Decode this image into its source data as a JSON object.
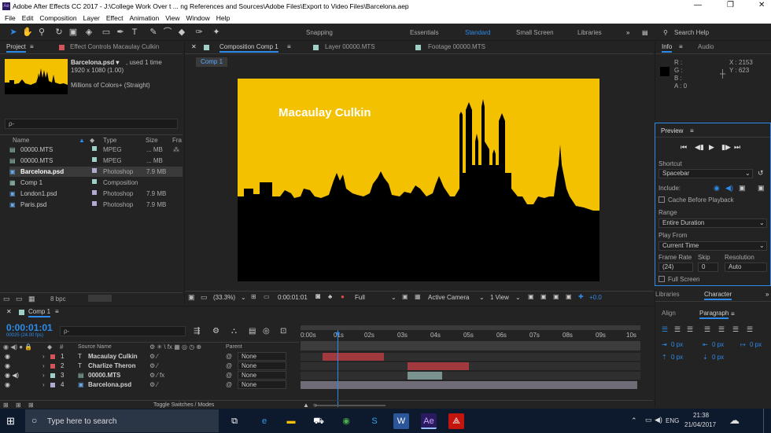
{
  "window": {
    "title": "Adobe After Effects CC 2017 - J:\\College Work Over t ... ng References and Sources\\Adobe Files\\Export to Video Files\\Barcelona.aep",
    "min": "—",
    "max": "❐",
    "close": "✕"
  },
  "menu": [
    "File",
    "Edit",
    "Composition",
    "Layer",
    "Effect",
    "Animation",
    "View",
    "Window",
    "Help"
  ],
  "toolbar": {
    "snapping": "Snapping",
    "workspaces": [
      "Essentials",
      "Standard",
      "Small Screen",
      "Libraries"
    ],
    "search_placeholder": "Search Help"
  },
  "project": {
    "tab": "Project",
    "effect_tab": "Effect Controls Macaulay Culkin",
    "selected_name": "Barcelona.psd ▾",
    "used": ", used 1 time",
    "dims": "1920 x 1080 (1.00)",
    "colors": "Millions of Colors+ (Straight)",
    "search_icon": "ρ-",
    "cols": [
      "Name",
      "Type",
      "Size",
      "Fra"
    ],
    "items": [
      {
        "name": "00000.MTS",
        "type": "MPEG",
        "size": "... MB",
        "color": "#9fd0c8"
      },
      {
        "name": "00000.MTS",
        "type": "MPEG",
        "size": "... MB",
        "color": "#9fd0c8"
      },
      {
        "name": "Barcelona.psd",
        "type": "Photoshop",
        "size": "7.9 MB",
        "color": "#b3a8d0"
      },
      {
        "name": "Comp 1",
        "type": "Composition",
        "size": "",
        "color": "#9fd0c8"
      },
      {
        "name": "London1.psd",
        "type": "Photoshop",
        "size": "7.9 MB",
        "color": "#b3a8d0"
      },
      {
        "name": "Paris.psd",
        "type": "Photoshop",
        "size": "7.9 MB",
        "color": "#b3a8d0"
      }
    ],
    "bpc": "8 bpc"
  },
  "comp": {
    "tabs": [
      "Composition Comp 1",
      "Layer 00000.MTS",
      "Footage 00000.MTS"
    ],
    "subtab": "Comp 1",
    "overlay_text": "Macaulay Culkin",
    "zoom": "(33.3%)",
    "time": "0:00:01:01",
    "resolution": "Full",
    "camera": "Active Camera",
    "view": "1 View",
    "exposure": "+0.0",
    "bg": "#f3c100"
  },
  "info": {
    "tabs": [
      "Info",
      "Audio"
    ],
    "r": "R :",
    "g": "G :",
    "b": "B :",
    "a": "A : 0",
    "x": "X : 2153",
    "y": "Y : 623"
  },
  "preview": {
    "title": "Preview",
    "shortcut_label": "Shortcut",
    "shortcut": "Spacebar",
    "include": "Include:",
    "cache": "Cache Before Playback",
    "range_label": "Range",
    "range": "Entire Duration",
    "playfrom_label": "Play From",
    "playfrom": "Current Time",
    "fr_label": "Frame Rate",
    "skip_label": "Skip",
    "res_label": "Resolution",
    "fr": "(24)",
    "skip": "0",
    "res": "Auto",
    "fullscreen": "Full Screen"
  },
  "character": {
    "tabs": [
      "Libraries",
      "Character"
    ],
    "align": "Align",
    "paragraph": "Paragraph",
    "px": [
      "0 px",
      "0 px",
      "0 px",
      "0 px",
      "0 px"
    ]
  },
  "timeline": {
    "tab": "Comp 1",
    "time": "0:00:01:01",
    "fps": "00025 (24.00 fps)",
    "cols": [
      "Source Name",
      "Parent"
    ],
    "ruler": [
      "0:00s",
      "01s",
      "02s",
      "03s",
      "04s",
      "05s",
      "06s",
      "07s",
      "08s",
      "09s",
      "10s"
    ],
    "layers": [
      {
        "num": "1",
        "type": "T",
        "name": "Macaulay Culkin",
        "parent": "None",
        "color": "#d0545a"
      },
      {
        "num": "2",
        "type": "T",
        "name": "Charlize Theron",
        "parent": "None",
        "color": "#d0545a"
      },
      {
        "num": "3",
        "type": "",
        "name": "00000.MTS",
        "parent": "None",
        "color": "#9fd0c8"
      },
      {
        "num": "4",
        "type": "",
        "name": "Barcelona.psd",
        "parent": "None",
        "color": "#b3a8d0"
      }
    ],
    "toggle": "Toggle Switches / Modes"
  },
  "taskbar": {
    "search": "Type here to search",
    "lang": "ENG",
    "time": "21:38",
    "date": "21/04/2017"
  }
}
